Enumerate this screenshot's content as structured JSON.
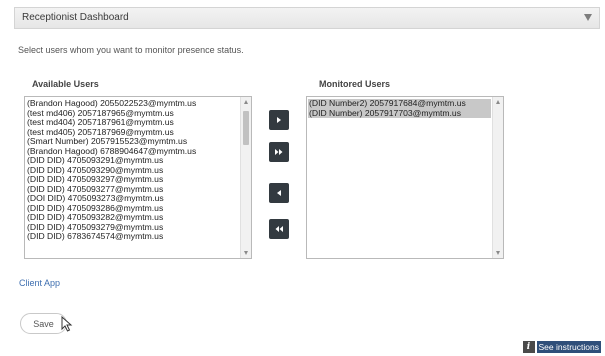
{
  "panel": {
    "title": "Receptionist Dashboard"
  },
  "instructions": "Select users whom you want to monitor presence status.",
  "available": {
    "heading": "Available Users",
    "items": [
      "(Brandon Hagood) 2055022523@mymtm.us",
      "(test md406) 2057187965@mymtm.us",
      "(test md404) 2057187961@mymtm.us",
      "(test md405) 2057187969@mymtm.us",
      "(Smart Number) 2057915523@mymtm.us",
      "(Brandon Hagood) 6788904647@mymtm.us",
      "(DID DID) 4705093291@mymtm.us",
      "(DID DID) 4705093290@mymtm.us",
      "(DID DID) 4705093297@mymtm.us",
      "(DID DID) 4705093277@mymtm.us",
      "(DOI DID) 4705093273@mymtm.us",
      "(DID DID) 4705093286@mymtm.us",
      "(DID DID) 4705093282@mymtm.us",
      "(DID DID) 4705093279@mymtm.us",
      "(DID DID) 6783674574@mymtm.us"
    ]
  },
  "monitored": {
    "heading": "Monitored Users",
    "items": [
      "(DID Number2) 2057917684@mymtm.us",
      "(DID Number) 2057917703@mymtm.us"
    ]
  },
  "buttons": {
    "add_selected": "chevron-right-icon",
    "add_all": "double-chevron-right-icon",
    "remove_selected": "chevron-left-icon",
    "remove_all": "double-chevron-left-icon"
  },
  "client_link": "Client App",
  "save_label": "Save",
  "help_link": "See instructions"
}
